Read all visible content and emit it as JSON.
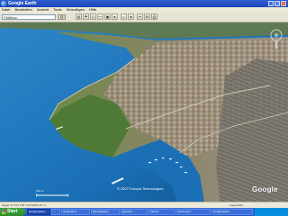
{
  "window": {
    "title": "Google Earth"
  },
  "menu": [
    "Datei",
    "Bearbeiten",
    "Ansicht",
    "Tools",
    "Hinzufügen",
    "Hilfe"
  ],
  "search": {
    "value": "Pfäffikon",
    "button_label": "Q"
  },
  "toolbar": {
    "icons": [
      "hide-sidebar-icon",
      "placemark-icon",
      "polygon-icon",
      "path-icon",
      "overlay-icon",
      "record-tour-icon",
      "sun-icon",
      "sky-icon",
      "ruler-icon",
      "email-icon",
      "print-icon"
    ]
  },
  "map": {
    "copyright": "© 2007 Europa Technologies",
    "logo": "Google",
    "scale_label": "126 m"
  },
  "status": {
    "coords": "Zeiger 47°12'27.82\" N  8°46'50.31\" O",
    "altitude": "",
    "streaming": "Augenhöhe"
  },
  "taskbar": {
    "start": "Start",
    "tasks": [
      "Google Earth",
      "...",
      "Unbenannt",
      "pferdegalopp",
      "geoview",
      "Yahoo!",
      "Dokument",
      "Google Earth"
    ],
    "clock": ""
  },
  "colors": {
    "titlebar": "#1b45b8",
    "lake": "#1a6fb5",
    "land": "#5d7a3a",
    "taskbar": "#2452c4"
  }
}
